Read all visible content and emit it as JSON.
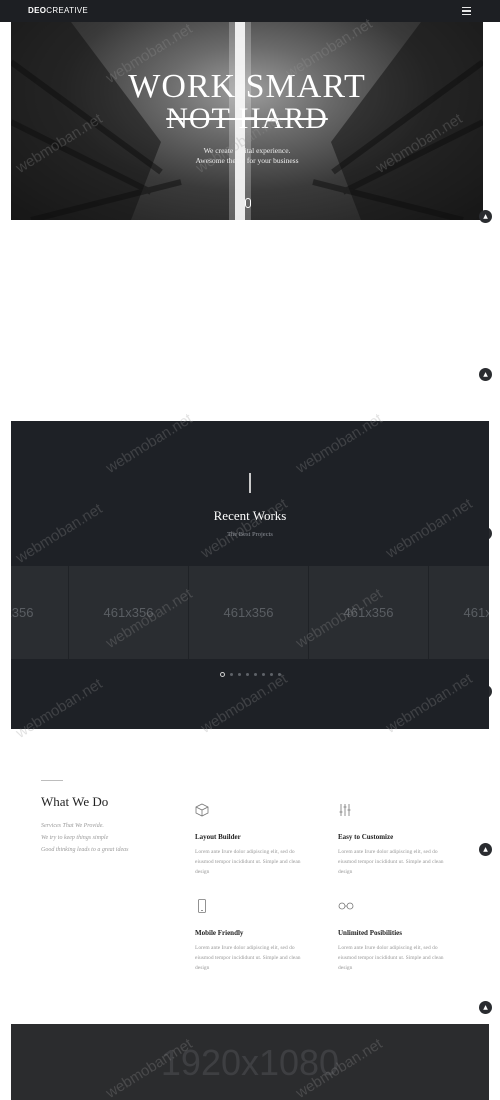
{
  "nav": {
    "logo_bold": "DEO",
    "logo_light": "CREATIVE",
    "menu_icon": "hamburger-menu-icon"
  },
  "hero": {
    "title_line1": "WORK SMART",
    "title_line2": "NOT HARD",
    "subtitle_line1": "We create digital experience.",
    "subtitle_line2": "Awesome theme for your business"
  },
  "works": {
    "title": "Recent Works",
    "subtitle": "The Best Projects",
    "slides": [
      "461x356",
      "461x356",
      "461x356",
      "461x356",
      "461x356"
    ],
    "dots_count": 8,
    "active_dot": 0
  },
  "what_we_do": {
    "title": "What We Do",
    "desc": [
      "Services That We Provide.",
      "We try to keep things simple",
      "Good thinking leads to a great ideas"
    ],
    "features": [
      {
        "icon": "cube-icon",
        "title": "Layout Builder",
        "text": "Lorem ante Irure dolor adipiscing elit, sed do eiusmod tempor incididunt ut. Simple and clean design"
      },
      {
        "icon": "sliders-icon",
        "title": "Easy to Customize",
        "text": "Lorem ante Irure dolor adipiscing elit, sed do eiusmod tempor incididunt ut. Simple and clean design"
      },
      {
        "icon": "mobile-icon",
        "title": "Mobile Friendly",
        "text": "Lorem ante Irure dolor adipiscing elit, sed do eiusmod tempor incididunt ut. Simple and clean design"
      },
      {
        "icon": "glasses-icon",
        "title": "Unlimited Posibilities",
        "text": "Lorem ante Irure dolor adipiscing elit, sed do eiusmod tempor incididunt ut. Simple and clean design"
      }
    ]
  },
  "placeholder": {
    "label": "1920x1080"
  },
  "watermark": "webmoban.net",
  "colors": {
    "dark": "#1e2126",
    "nav": "#1d1f23",
    "placeholder": "#2b2c2e"
  }
}
